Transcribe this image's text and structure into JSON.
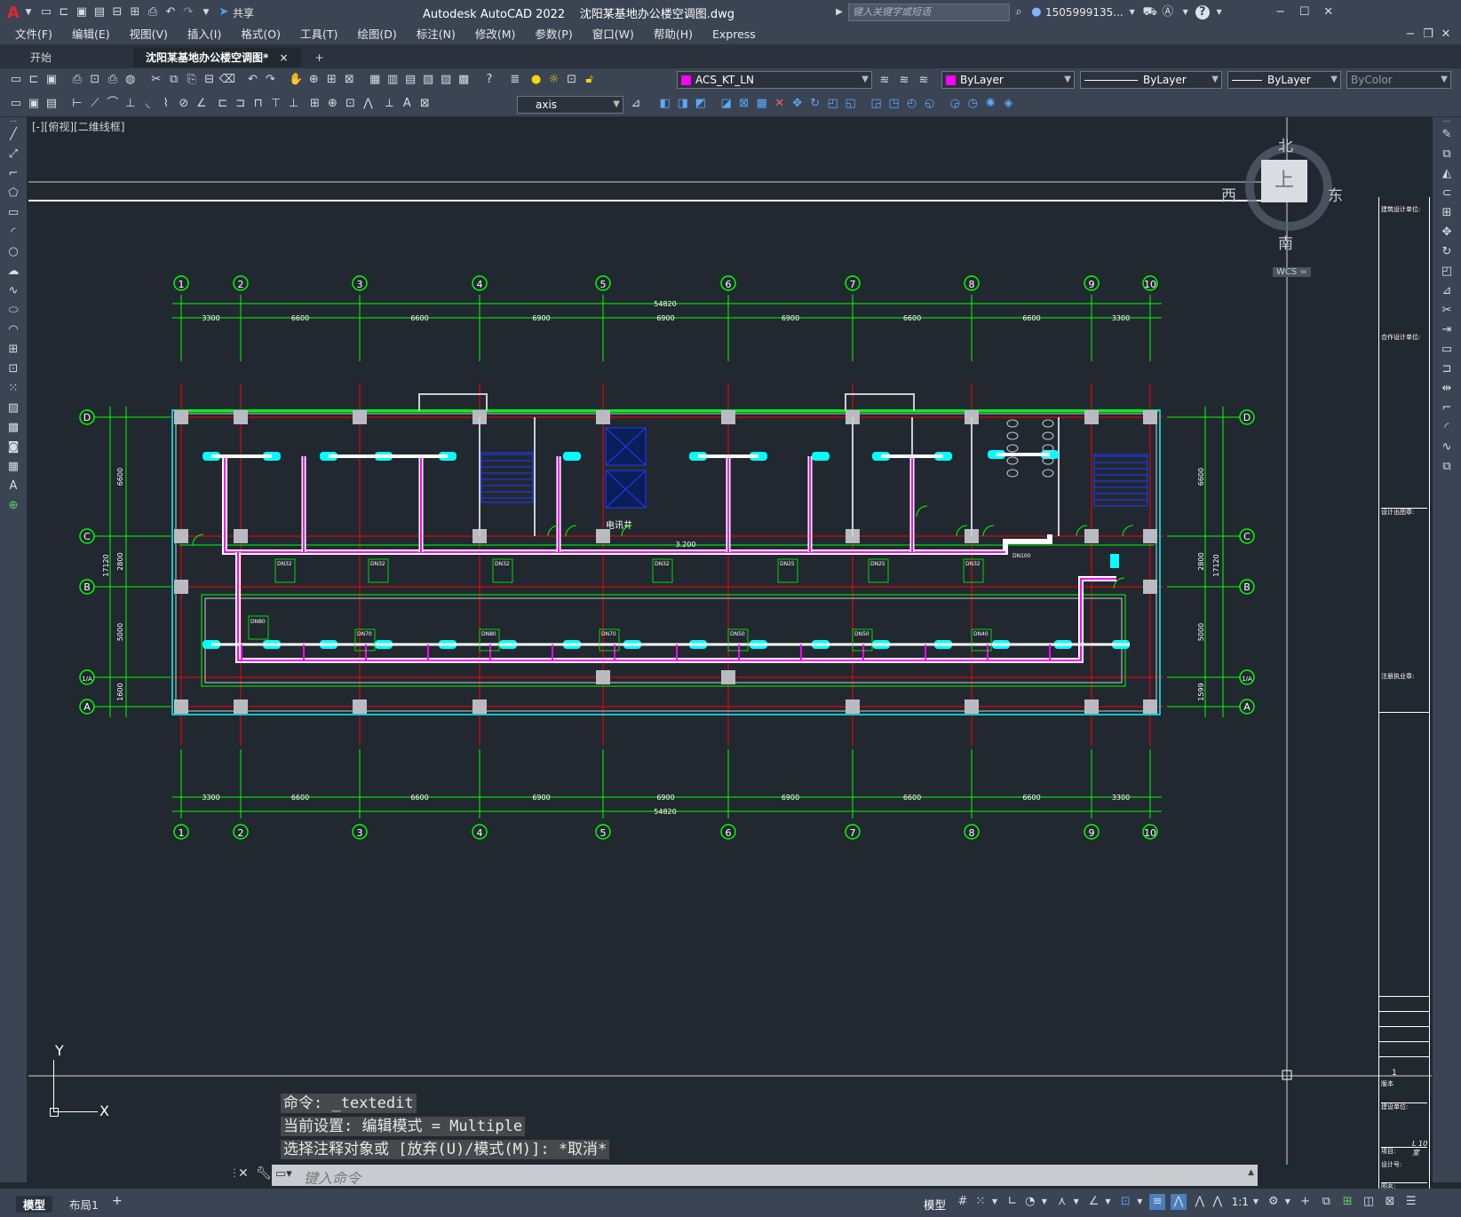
{
  "titlebar": {
    "app_logo": "A",
    "share_label": "共享",
    "title": "Autodesk AutoCAD 2022    沈阳某基地办公楼空调图.dwg",
    "search_placeholder": "键入关键字或短语",
    "user": "1505999135...",
    "help": "?"
  },
  "menu": [
    "文件(F)",
    "编辑(E)",
    "视图(V)",
    "插入(I)",
    "格式(O)",
    "工具(T)",
    "绘图(D)",
    "标注(N)",
    "修改(M)",
    "参数(P)",
    "窗口(W)",
    "帮助(H)",
    "Express"
  ],
  "tabs": {
    "start": "开始",
    "document": "沈阳某基地办公楼空调图*",
    "close": "×",
    "add": "+"
  },
  "toolbar": {
    "layer": "ACS_KT_LN",
    "color": "ByLayer",
    "linetype": "ByLayer",
    "lineweight": "ByLayer",
    "plotstyle": "ByColor",
    "dimstyle": "axis"
  },
  "viewport_label": "[-][俯视][二维线框]",
  "viewcube": {
    "north": "北",
    "south": "南",
    "east": "东",
    "west": "西",
    "top": "上",
    "wcs": "WCS ="
  },
  "ucs": {
    "x": "X",
    "y": "Y"
  },
  "drawing": {
    "grid_x": [
      "1",
      "2",
      "3",
      "4",
      "5",
      "6",
      "7",
      "8",
      "9",
      "10"
    ],
    "grid_y": [
      "D",
      "C",
      "B",
      "1/A",
      "A"
    ],
    "spans_top": [
      "3300",
      "6600",
      "6600",
      "6900",
      "6900",
      "6900",
      "6600",
      "6600",
      "3300"
    ],
    "spans_bottom": [
      "3300",
      "6600",
      "6600",
      "6900",
      "6900",
      "6900",
      "6600",
      "6600",
      "3300"
    ],
    "total": "54820",
    "left_dims": [
      "6600",
      "2800",
      "5000",
      "1600"
    ],
    "left_total": "17120",
    "right_dims": [
      "6600",
      "2800",
      "5000",
      "1599"
    ],
    "right_total": "17120",
    "room_label": "电讯井",
    "level": "3.200",
    "pipe_upper": [
      "DN32",
      "DN32",
      "DN32",
      "DN32",
      "DN25",
      "DN25",
      "DN32"
    ],
    "pipe_lower": [
      "DN70",
      "DN80",
      "DN70",
      "DN50",
      "DN50",
      "DN40"
    ],
    "pipe_main": "DN100",
    "left_pipe": "DN80"
  },
  "title_block": {
    "design_unit": "建筑设计单位:",
    "coop_unit": "合作设计单位:",
    "stamp": "设计出图章:",
    "reg_stamp": "注册执业章:",
    "version": "1",
    "version_label": "版本",
    "build_unit": "建设单位:",
    "project": "项目:",
    "drawing_name": "图名:",
    "sheet_no": "L 10室",
    "design_no": "设计号:"
  },
  "command": {
    "line1": "命令: _textedit",
    "line2": "当前设置: 编辑模式 = Multiple",
    "line3": "选择注释对象或 [放弃(U)/模式(M)]: *取消*",
    "placeholder": "键入命令"
  },
  "status": {
    "model_tab": "模型",
    "layout_tab": "布局1",
    "add": "+",
    "model_btn": "模型",
    "scale": "1:1"
  },
  "colors": {
    "bg": "#212830",
    "green": "#00ff00",
    "magenta": "#ff00ff",
    "cyan": "#00ffff",
    "red": "#ff0000",
    "white": "#ffffff"
  }
}
